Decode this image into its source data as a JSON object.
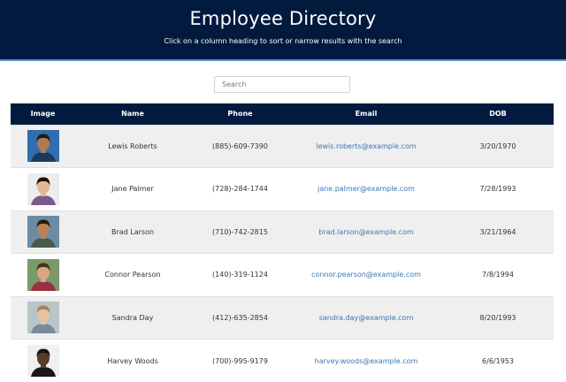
{
  "header": {
    "title": "Employee Directory",
    "subtitle": "Click on a column heading to sort or narrow results with the search"
  },
  "search": {
    "placeholder": "Search",
    "value": ""
  },
  "table": {
    "columns": [
      "Image",
      "Name",
      "Phone",
      "Email",
      "DOB"
    ],
    "rows": [
      {
        "name": "Lewis Roberts",
        "phone": "(885)-609-7390",
        "email": "lewis.roberts@example.com",
        "dob": "3/20/1970",
        "avatar": {
          "bg": "#2f6fae",
          "skin": "#b07a55",
          "hair": "#2a1a10",
          "shirt": "#1e3a5a"
        }
      },
      {
        "name": "Jane Palmer",
        "phone": "(728)-284-1744",
        "email": "jane.palmer@example.com",
        "dob": "7/28/1993",
        "avatar": {
          "bg": "#ececec",
          "skin": "#e2b895",
          "hair": "#1a1410",
          "shirt": "#7a5a8a"
        }
      },
      {
        "name": "Brad Larson",
        "phone": "(710)-742-2815",
        "email": "brad.larson@example.com",
        "dob": "3/21/1964",
        "avatar": {
          "bg": "#6a8ca4",
          "skin": "#b8835c",
          "hair": "#2a1c12",
          "shirt": "#4a5a4a"
        }
      },
      {
        "name": "Connor Pearson",
        "phone": "(140)-319-1124",
        "email": "connor.pearson@example.com",
        "dob": "7/8/1994",
        "avatar": {
          "bg": "#7a9a6a",
          "skin": "#d8a682",
          "hair": "#4a3020",
          "shirt": "#9a3040"
        }
      },
      {
        "name": "Sandra Day",
        "phone": "(412)-635-2854",
        "email": "sandra.day@example.com",
        "dob": "8/20/1993",
        "avatar": {
          "bg": "#b8c4c8",
          "skin": "#e6c2a2",
          "hair": "#a58560",
          "shirt": "#7a8a9a"
        }
      },
      {
        "name": "Harvey Woods",
        "phone": "(700)-995-9179",
        "email": "harvey.woods@example.com",
        "dob": "6/6/1953",
        "avatar": {
          "bg": "#f0f0f0",
          "skin": "#5a3a28",
          "hair": "#1a1210",
          "shirt": "#1a1a1a"
        }
      }
    ]
  }
}
